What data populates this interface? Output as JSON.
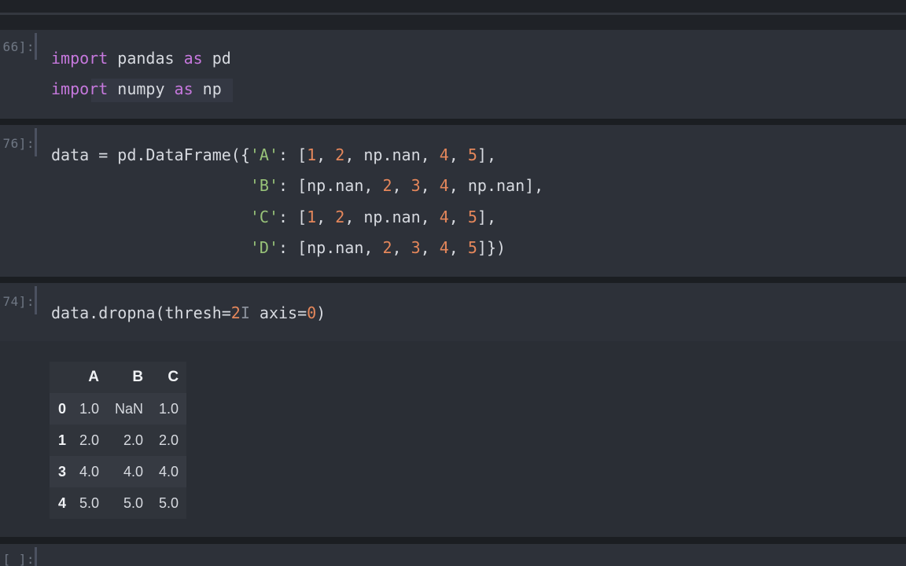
{
  "cells": [
    {
      "prompt": "66]:",
      "lines": [
        [
          {
            "t": "import",
            "c": "kw"
          },
          {
            "t": " pandas ",
            "c": "plain"
          },
          {
            "t": "as",
            "c": "kw"
          },
          {
            "t": " pd",
            "c": "plain"
          }
        ],
        [
          {
            "t": "import",
            "c": "kw"
          },
          {
            "t": " numpy ",
            "c": "plain"
          },
          {
            "t": "as",
            "c": "kw"
          },
          {
            "t": " np",
            "c": "plain"
          }
        ]
      ]
    },
    {
      "prompt": "76]:",
      "lines": [
        [
          {
            "t": "data = pd.DataFrame({",
            "c": "plain"
          },
          {
            "t": "'A'",
            "c": "str"
          },
          {
            "t": ": [",
            "c": "plain"
          },
          {
            "t": "1",
            "c": "num"
          },
          {
            "t": ", ",
            "c": "plain"
          },
          {
            "t": "2",
            "c": "num"
          },
          {
            "t": ", np.nan, ",
            "c": "plain"
          },
          {
            "t": "4",
            "c": "num"
          },
          {
            "t": ", ",
            "c": "plain"
          },
          {
            "t": "5",
            "c": "num"
          },
          {
            "t": "],",
            "c": "plain"
          }
        ],
        [
          {
            "t": "                     ",
            "c": "plain"
          },
          {
            "t": "'B'",
            "c": "str"
          },
          {
            "t": ": [np.nan, ",
            "c": "plain"
          },
          {
            "t": "2",
            "c": "num"
          },
          {
            "t": ", ",
            "c": "plain"
          },
          {
            "t": "3",
            "c": "num"
          },
          {
            "t": ", ",
            "c": "plain"
          },
          {
            "t": "4",
            "c": "num"
          },
          {
            "t": ", np.nan],",
            "c": "plain"
          }
        ],
        [
          {
            "t": "                     ",
            "c": "plain"
          },
          {
            "t": "'C'",
            "c": "str"
          },
          {
            "t": ": [",
            "c": "plain"
          },
          {
            "t": "1",
            "c": "num"
          },
          {
            "t": ", ",
            "c": "plain"
          },
          {
            "t": "2",
            "c": "num"
          },
          {
            "t": ", np.nan, ",
            "c": "plain"
          },
          {
            "t": "4",
            "c": "num"
          },
          {
            "t": ", ",
            "c": "plain"
          },
          {
            "t": "5",
            "c": "num"
          },
          {
            "t": "],",
            "c": "plain"
          }
        ],
        [
          {
            "t": "                     ",
            "c": "plain"
          },
          {
            "t": "'D'",
            "c": "str"
          },
          {
            "t": ": [np.nan, ",
            "c": "plain"
          },
          {
            "t": "2",
            "c": "num"
          },
          {
            "t": ", ",
            "c": "plain"
          },
          {
            "t": "3",
            "c": "num"
          },
          {
            "t": ", ",
            "c": "plain"
          },
          {
            "t": "4",
            "c": "num"
          },
          {
            "t": ", ",
            "c": "plain"
          },
          {
            "t": "5",
            "c": "num"
          },
          {
            "t": "]})",
            "c": "plain"
          }
        ]
      ]
    },
    {
      "prompt": "74]:",
      "lines": [
        [
          {
            "t": "data.dropna(thresh=",
            "c": "plain"
          },
          {
            "t": "2",
            "c": "num"
          },
          {
            "t": "I",
            "c": "cursor"
          },
          {
            "t": " axis=",
            "c": "plain"
          },
          {
            "t": "0",
            "c": "num"
          },
          {
            "t": ")",
            "c": "plain"
          }
        ]
      ]
    }
  ],
  "output_table": {
    "columns": [
      "",
      "A",
      "B",
      "C"
    ],
    "rows": [
      {
        "index": "0",
        "cells": [
          "1.0",
          "NaN",
          "1.0"
        ]
      },
      {
        "index": "1",
        "cells": [
          "2.0",
          "2.0",
          "2.0"
        ]
      },
      {
        "index": "3",
        "cells": [
          "4.0",
          "4.0",
          "4.0"
        ]
      },
      {
        "index": "4",
        "cells": [
          "5.0",
          "5.0",
          "5.0"
        ]
      }
    ]
  },
  "next_prompt": "[ ]:",
  "colors": {
    "keyword": "#c678dd",
    "string": "#98c379",
    "number": "#e5875b",
    "text": "#d7dae0"
  }
}
